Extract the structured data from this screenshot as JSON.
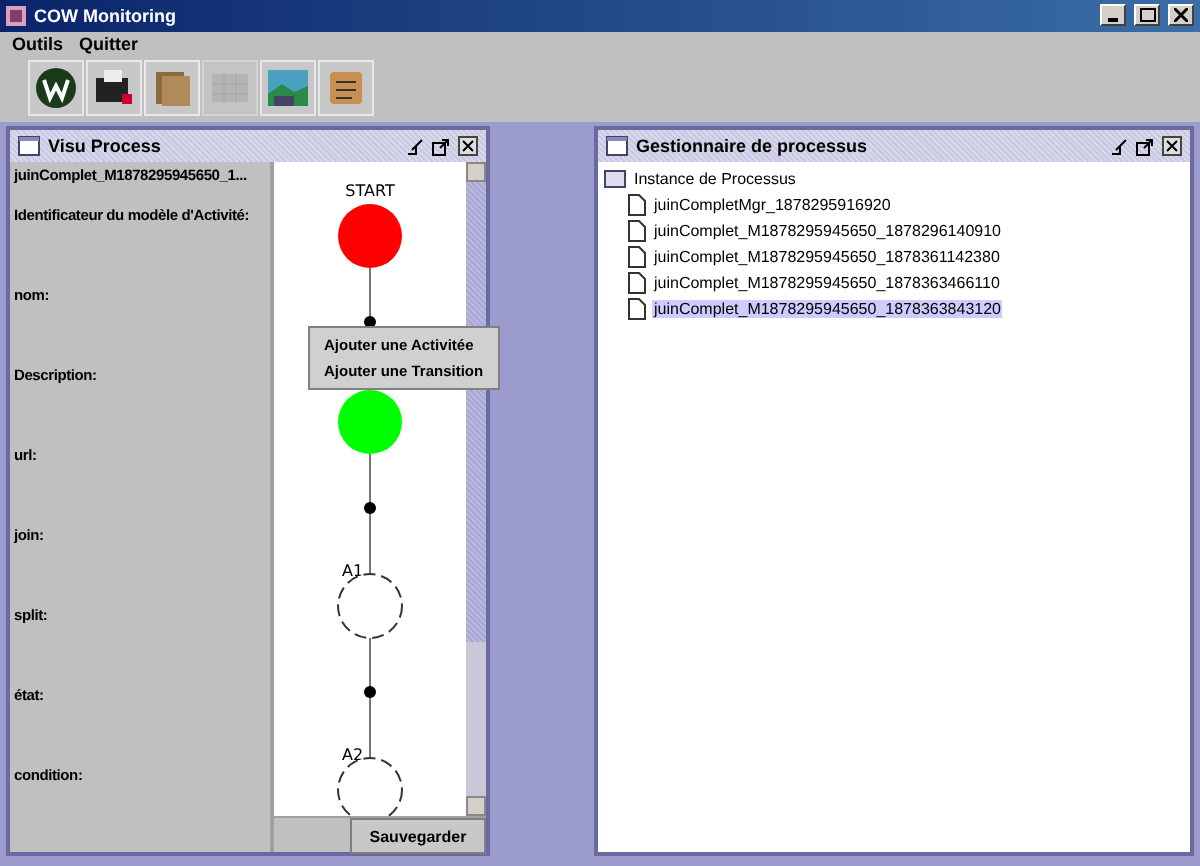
{
  "window": {
    "title": "COW Monitoring"
  },
  "menu": [
    "Outils",
    "Quitter"
  ],
  "toolbar": [
    {
      "kind": "globe",
      "disabled": false
    },
    {
      "kind": "printer",
      "disabled": false
    },
    {
      "kind": "folders",
      "disabled": false
    },
    {
      "kind": "grid",
      "disabled": true
    },
    {
      "kind": "landscape",
      "disabled": false
    },
    {
      "kind": "scroll",
      "disabled": false
    }
  ],
  "visu_process": {
    "title": "Visu Process",
    "process_id": "juinComplet_M1878295945650_1...",
    "fields": [
      "Identificateur du modèle d'Activité:",
      "nom:",
      "Description:",
      "url:",
      "join:",
      "split:",
      "état:",
      "condition:"
    ],
    "nodes": [
      {
        "kind": "activity",
        "label": "START",
        "color": "#ff0000"
      },
      {
        "kind": "transition"
      },
      {
        "kind": "activity",
        "color": "#00ff00"
      },
      {
        "kind": "transition"
      },
      {
        "kind": "activity",
        "label": "A1"
      },
      {
        "kind": "transition"
      },
      {
        "kind": "activity",
        "label": "A2"
      }
    ],
    "context_menu": [
      "Ajouter une Activitée",
      "Ajouter une Transition"
    ],
    "save_button": "Sauvegarder"
  },
  "process_manager": {
    "title": "Gestionnaire de processus",
    "root": "Instance de Processus",
    "children": [
      {
        "label": "juinCompletMgr_1878295916920",
        "selected": false
      },
      {
        "label": "juinComplet_M1878295945650_1878296140910",
        "selected": false
      },
      {
        "label": "juinComplet_M1878295945650_1878361142380",
        "selected": false
      },
      {
        "label": "juinComplet_M1878295945650_1878363466110",
        "selected": false
      },
      {
        "label": "juinComplet_M1878295945650_1878363843120",
        "selected": true
      }
    ]
  }
}
